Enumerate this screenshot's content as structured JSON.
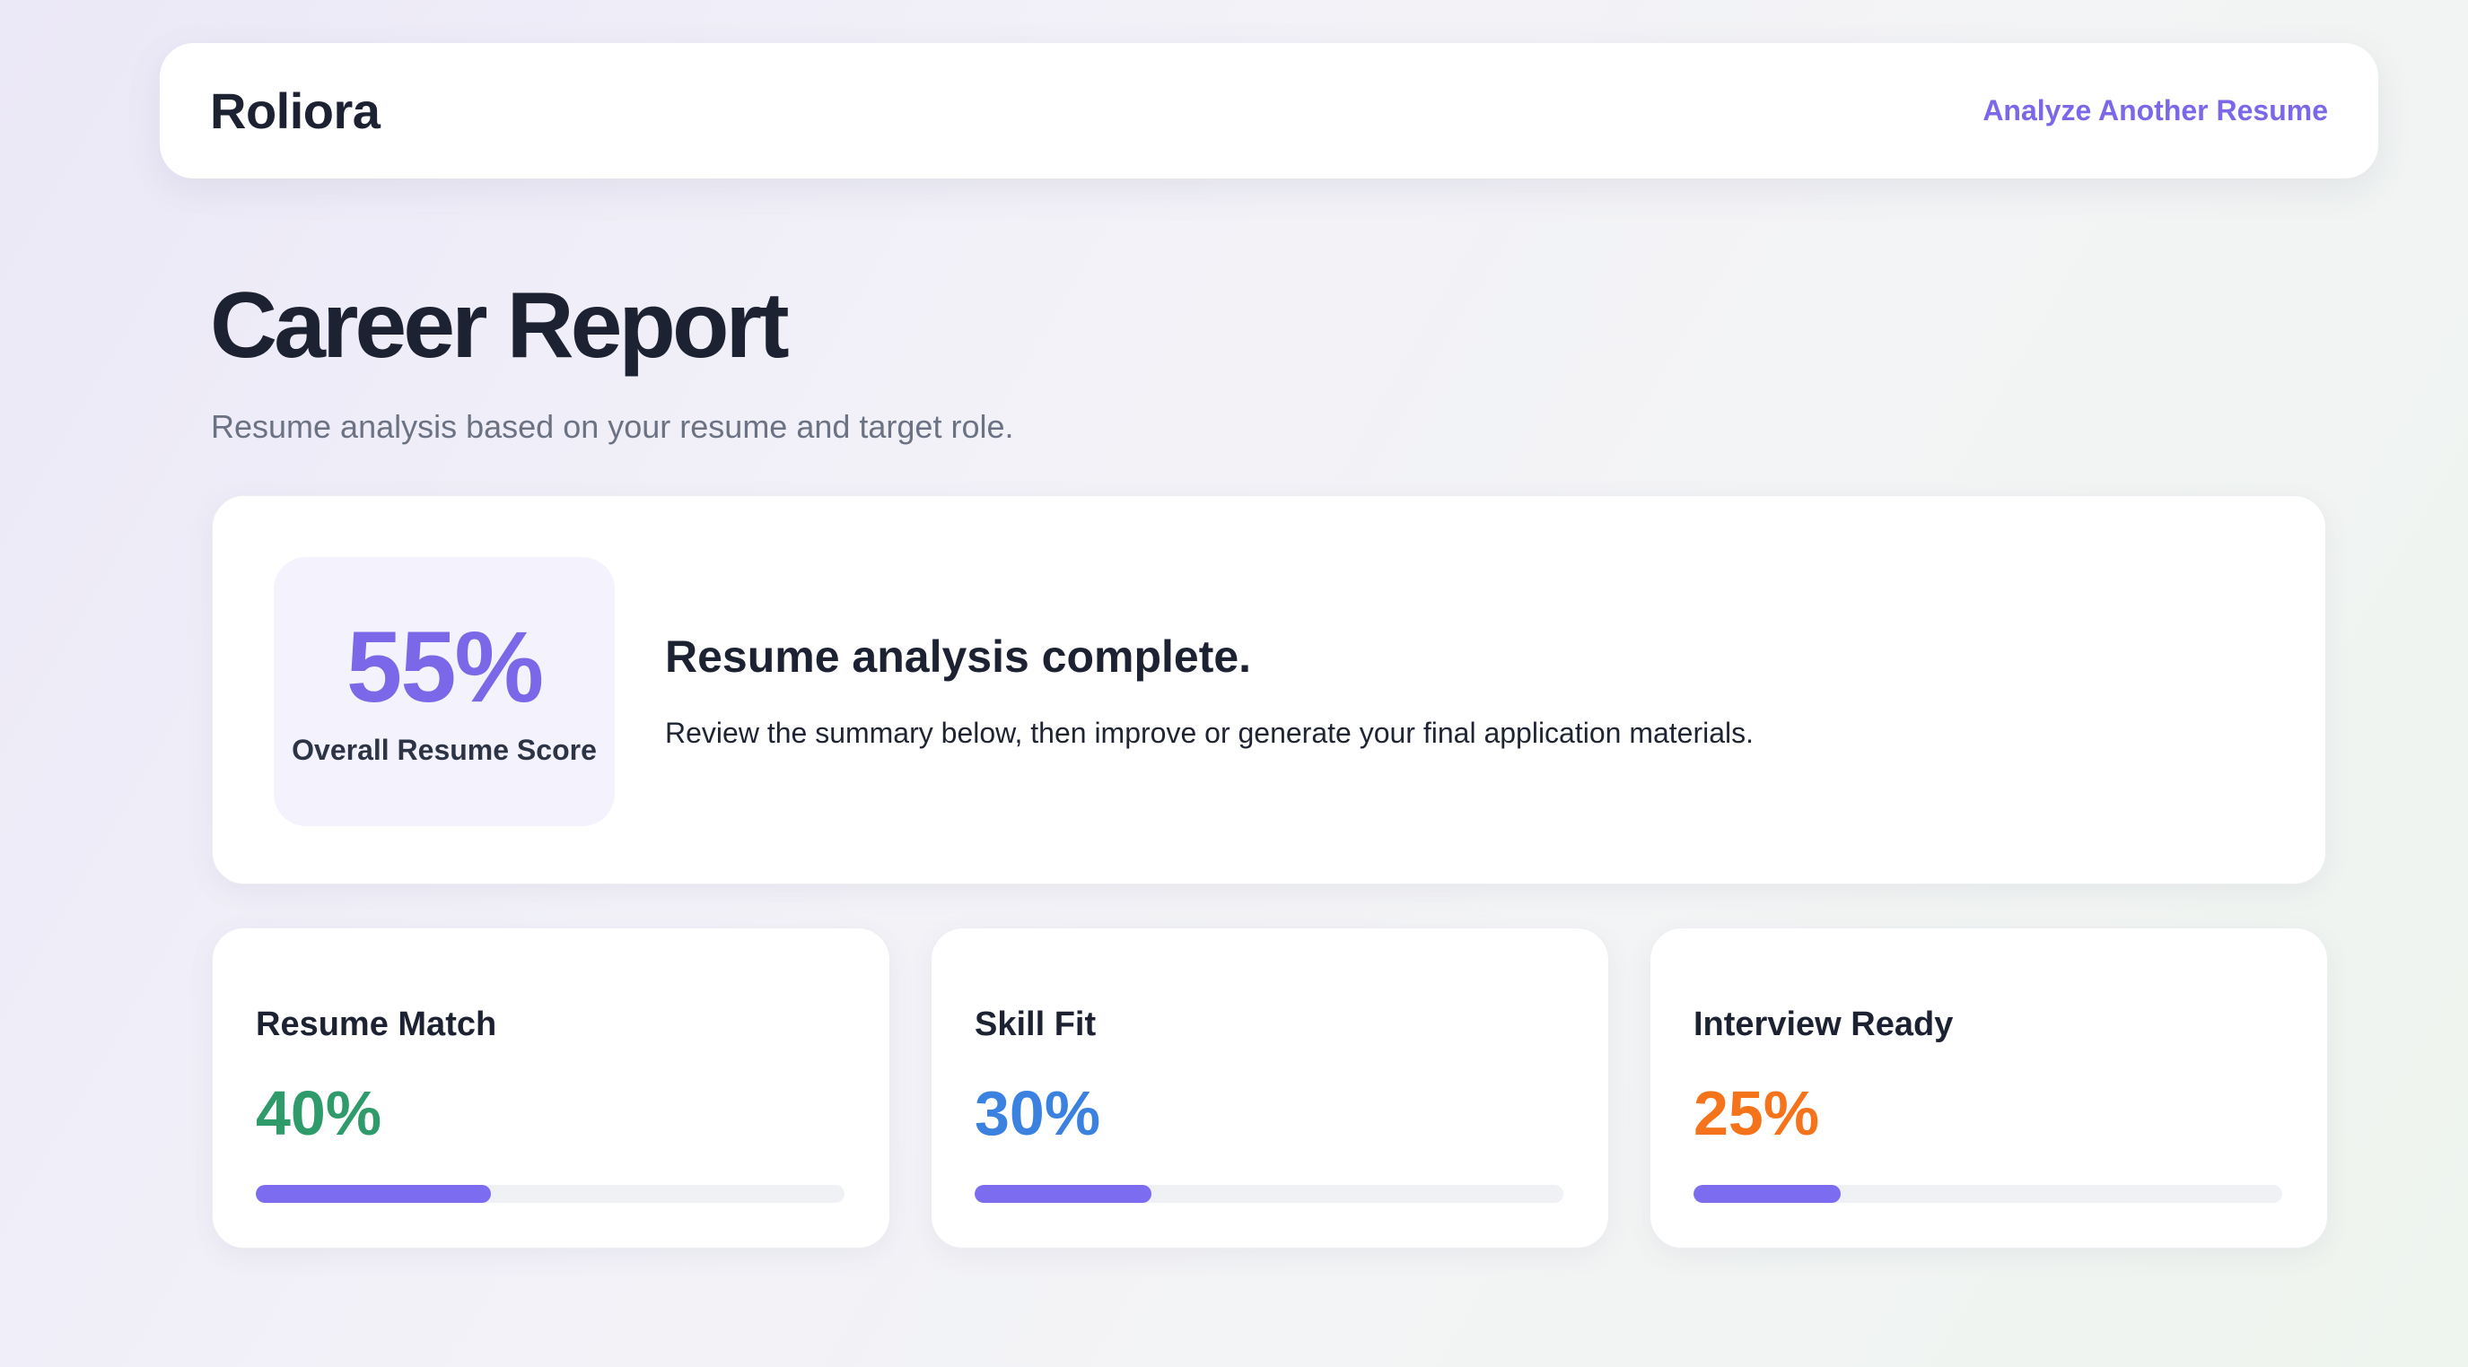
{
  "header": {
    "brand": "Roliora",
    "action_link": "Analyze Another Resume"
  },
  "page": {
    "title": "Career Report",
    "subtitle": "Resume analysis based on your resume and target role."
  },
  "summary": {
    "score": "55%",
    "score_label": "Overall Resume Score",
    "title": "Resume analysis complete.",
    "text": "Review the summary below, then improve or generate your final application materials."
  },
  "metrics": [
    {
      "label": "Resume Match",
      "value": "40%",
      "progress": 40,
      "color": "#2f9a6a"
    },
    {
      "label": "Skill Fit",
      "value": "30%",
      "progress": 30,
      "color": "#3b82e0"
    },
    {
      "label": "Interview Ready",
      "value": "25%",
      "progress": 25,
      "color": "#f5731a"
    }
  ],
  "colors": {
    "accent": "#7b68e8",
    "progress_fill": "#7b6cf0"
  }
}
